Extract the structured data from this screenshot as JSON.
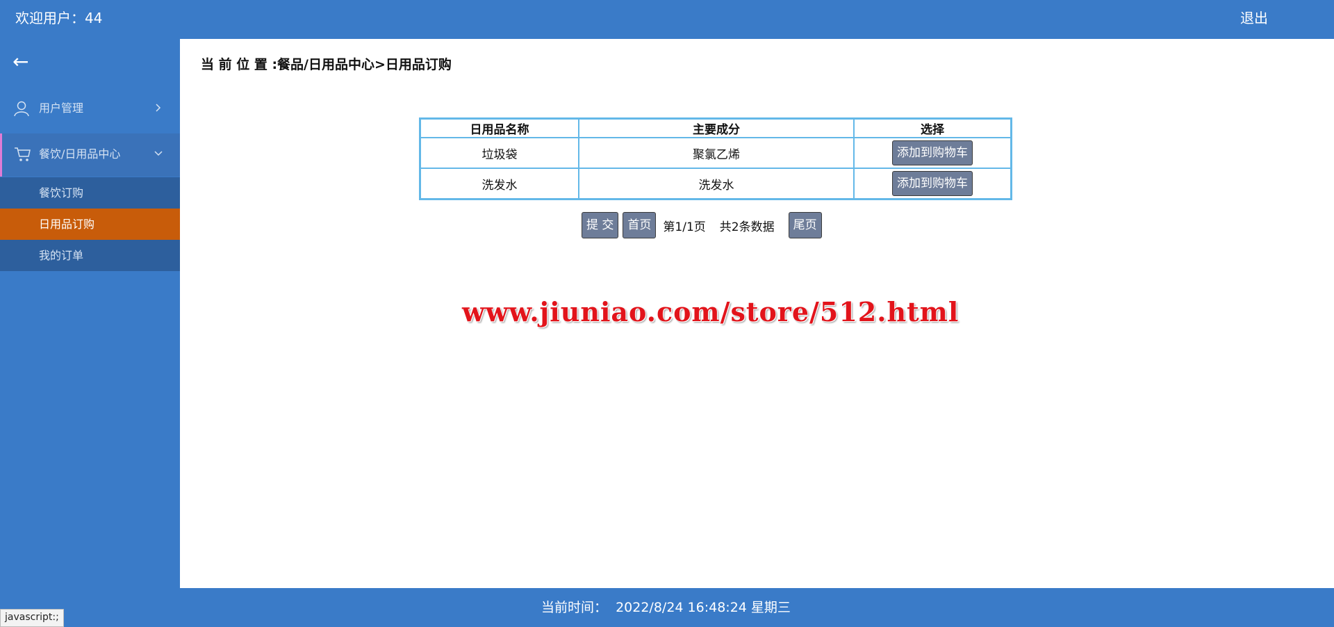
{
  "header": {
    "welcome": "欢迎用户：44",
    "logout": "退出"
  },
  "sidebar": {
    "back_icon": "arrow-left-icon",
    "menu": [
      {
        "label": "用户管理",
        "icon": "user-icon",
        "chevron": "chevron-right-icon"
      },
      {
        "label": "餐饮/日用品中心",
        "icon": "cart-icon",
        "chevron": "chevron-down-icon"
      }
    ],
    "submenu": [
      {
        "label": "餐饮订购"
      },
      {
        "label": "日用品订购",
        "active": true
      },
      {
        "label": "我的订单"
      }
    ]
  },
  "main": {
    "breadcrumb": "当 前 位 置 :餐品/日用品中心>日用品订购",
    "table": {
      "headers": [
        "日用品名称",
        "主要成分",
        "选择"
      ],
      "rows": [
        {
          "name": "垃圾袋",
          "ingredient": "聚氯乙烯",
          "action": "添加到购物车"
        },
        {
          "name": "洗发水",
          "ingredient": "洗发水",
          "action": "添加到购物车"
        }
      ]
    },
    "pager": {
      "submit": "提 交",
      "first": "首页",
      "page_info": "第1/1页",
      "total": "共2条数据",
      "last": "尾页"
    },
    "watermark": "www.jiuniao.com/store/512.html"
  },
  "footer": {
    "time": "当前时间：  2022/8/24 16:48:24 星期三"
  },
  "status_tip": "javascript:;",
  "colors": {
    "primary": "#3a7bc8",
    "submenu_bg": "#2d5f9d",
    "active_item": "#c85c0a",
    "table_border": "#63b8e8",
    "button_bg": "#6e7d99",
    "watermark": "#e2141b"
  }
}
